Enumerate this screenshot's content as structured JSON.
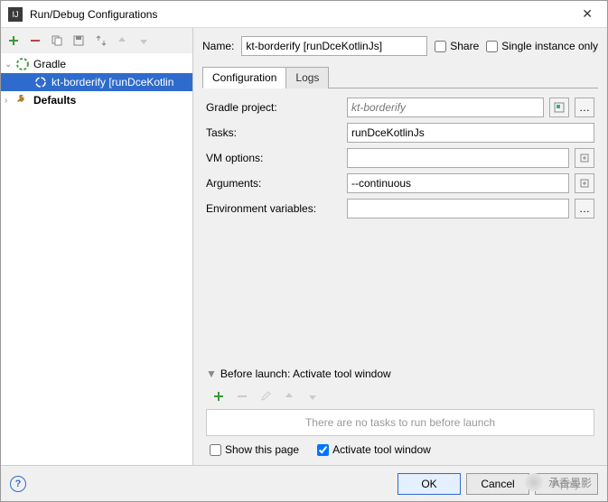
{
  "window": {
    "title": "Run/Debug Configurations"
  },
  "top": {
    "name_label": "Name:",
    "name_value": "kt-borderify [runDceKotlinJs]",
    "share_label": "Share",
    "single_instance_label": "Single instance only"
  },
  "tree": {
    "gradle": {
      "label": "Gradle"
    },
    "selected": {
      "label": "kt-borderify [runDceKotlin"
    },
    "defaults": {
      "label": "Defaults"
    }
  },
  "tabs": {
    "configuration": "Configuration",
    "logs": "Logs"
  },
  "form": {
    "gradle_project_label": "Gradle project:",
    "gradle_project_value": "kt-borderify",
    "tasks_label": "Tasks:",
    "tasks_value": "runDceKotlinJs",
    "vm_options_label": "VM options:",
    "vm_options_value": "",
    "arguments_label": "Arguments:",
    "arguments_value": "--continuous",
    "env_vars_label": "Environment variables:",
    "env_vars_value": ""
  },
  "before_launch": {
    "header": "Before launch: Activate tool window",
    "empty_text": "There are no tasks to run before launch",
    "show_this_page": "Show this page",
    "activate_tool_window": "Activate tool window"
  },
  "buttons": {
    "ok": "OK",
    "cancel": "Cancel",
    "apply": "Apply"
  },
  "watermark": "承香墨影"
}
